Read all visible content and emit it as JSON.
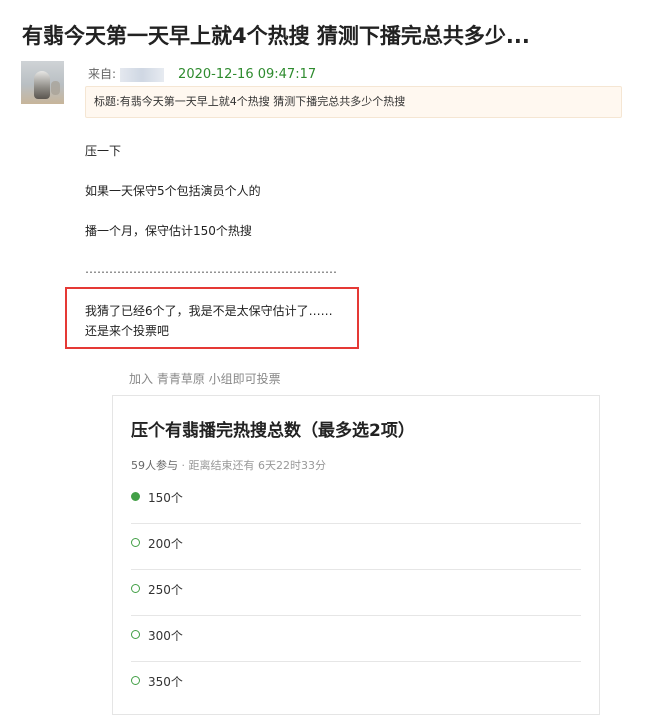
{
  "post": {
    "title": "有翡今天第一天早上就4个热搜 猜测下播完总共多少...",
    "from_label": "来自:",
    "date": "2020-12-16 09:47:17",
    "topic_prefix": "标题:",
    "topic_text": "有翡今天第一天早上就4个热搜 猜测下播完总共多少个热搜",
    "paragraphs": [
      "压一下",
      "如果一天保守5个包括演员个人的",
      "播一个月，保守估计150个热搜",
      "………………………………………………………"
    ],
    "highlight_lines": [
      "我猜了已经6个了，我是不是太保守估计了……",
      "还是来个投票吧"
    ]
  },
  "poll": {
    "join_hint": "加入 青青草原 小组即可投票",
    "title": "压个有翡播完热搜总数（最多选2项）",
    "participants": "59人参与",
    "separator": " · ",
    "remaining": "距离结束还有 6天22时33分",
    "options": [
      {
        "label": "150个",
        "selected": true
      },
      {
        "label": "200个",
        "selected": false
      },
      {
        "label": "250个",
        "selected": false
      },
      {
        "label": "300个",
        "selected": false
      },
      {
        "label": "350个",
        "selected": false
      }
    ]
  },
  "colors": {
    "accent_green": "#43a047",
    "date_green": "#2e8b2e",
    "highlight_red": "#e53935",
    "topic_bg": "#fff8f0"
  }
}
